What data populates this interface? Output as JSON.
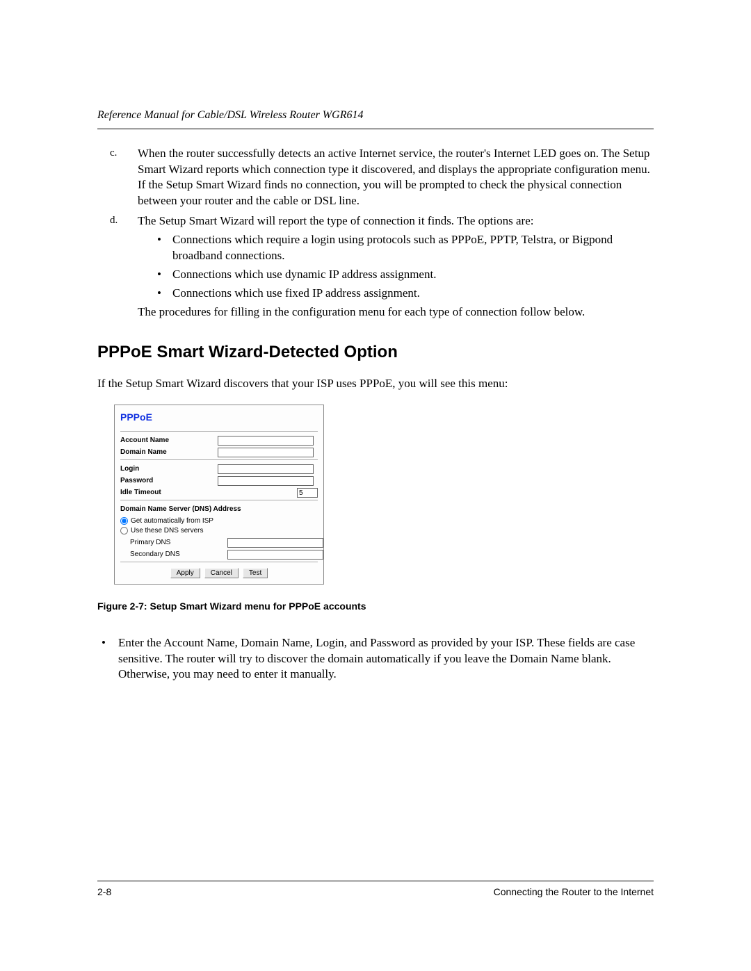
{
  "header": {
    "running_title": "Reference Manual for Cable/DSL Wireless Router WGR614"
  },
  "list": {
    "c_marker": "c.",
    "c_text": "When the router successfully detects an active Internet service, the router's Internet LED goes on. The Setup Smart Wizard reports which connection type it discovered, and displays the appropriate configuration menu. If the Setup Smart Wizard finds no connection, you will be prompted to check the physical connection between your router and the cable or DSL line.",
    "d_marker": "d.",
    "d_text": "The Setup Smart Wizard will report the type of connection it finds. The options are:",
    "d_sub": [
      "Connections which require a login using protocols such as PPPoE, PPTP, Telstra, or Bigpond broadband connections.",
      "Connections which use dynamic IP address assignment.",
      "Connections which use fixed IP address assignment."
    ],
    "d_tail": "The procedures for filling in the configuration menu for each type of connection follow below."
  },
  "section": {
    "heading": "PPPoE Smart Wizard-Detected Option",
    "intro": "If the Setup Smart Wizard discovers that your ISP uses PPPoE, you will see this menu:"
  },
  "form": {
    "title": "PPPoE",
    "account_name_label": "Account Name",
    "account_name_value": "",
    "domain_name_label": "Domain Name",
    "domain_name_value": "",
    "login_label": "Login",
    "login_value": "",
    "password_label": "Password",
    "password_value": "",
    "idle_label": "Idle Timeout",
    "idle_value": "5",
    "dns_heading": "Domain Name Server (DNS) Address",
    "dns_auto_label": "Get automatically from ISP",
    "dns_use_label": "Use these DNS servers",
    "dns_selected": "auto",
    "primary_dns_label": "Primary DNS",
    "primary_dns_value": "",
    "secondary_dns_label": "Secondary DNS",
    "secondary_dns_value": "",
    "apply_label": "Apply",
    "cancel_label": "Cancel",
    "test_label": "Test"
  },
  "figure_caption": "Figure 2-7:  Setup Smart Wizard menu for PPPoE accounts",
  "bottom_bullet": "Enter the Account Name, Domain Name, Login, and Password as provided by your ISP. These fields are case sensitive. The router will try to discover the domain automatically if you leave the Domain Name blank. Otherwise, you may need to enter it manually.",
  "footer": {
    "page_num": "2-8",
    "section_title": "Connecting the Router to the Internet"
  }
}
